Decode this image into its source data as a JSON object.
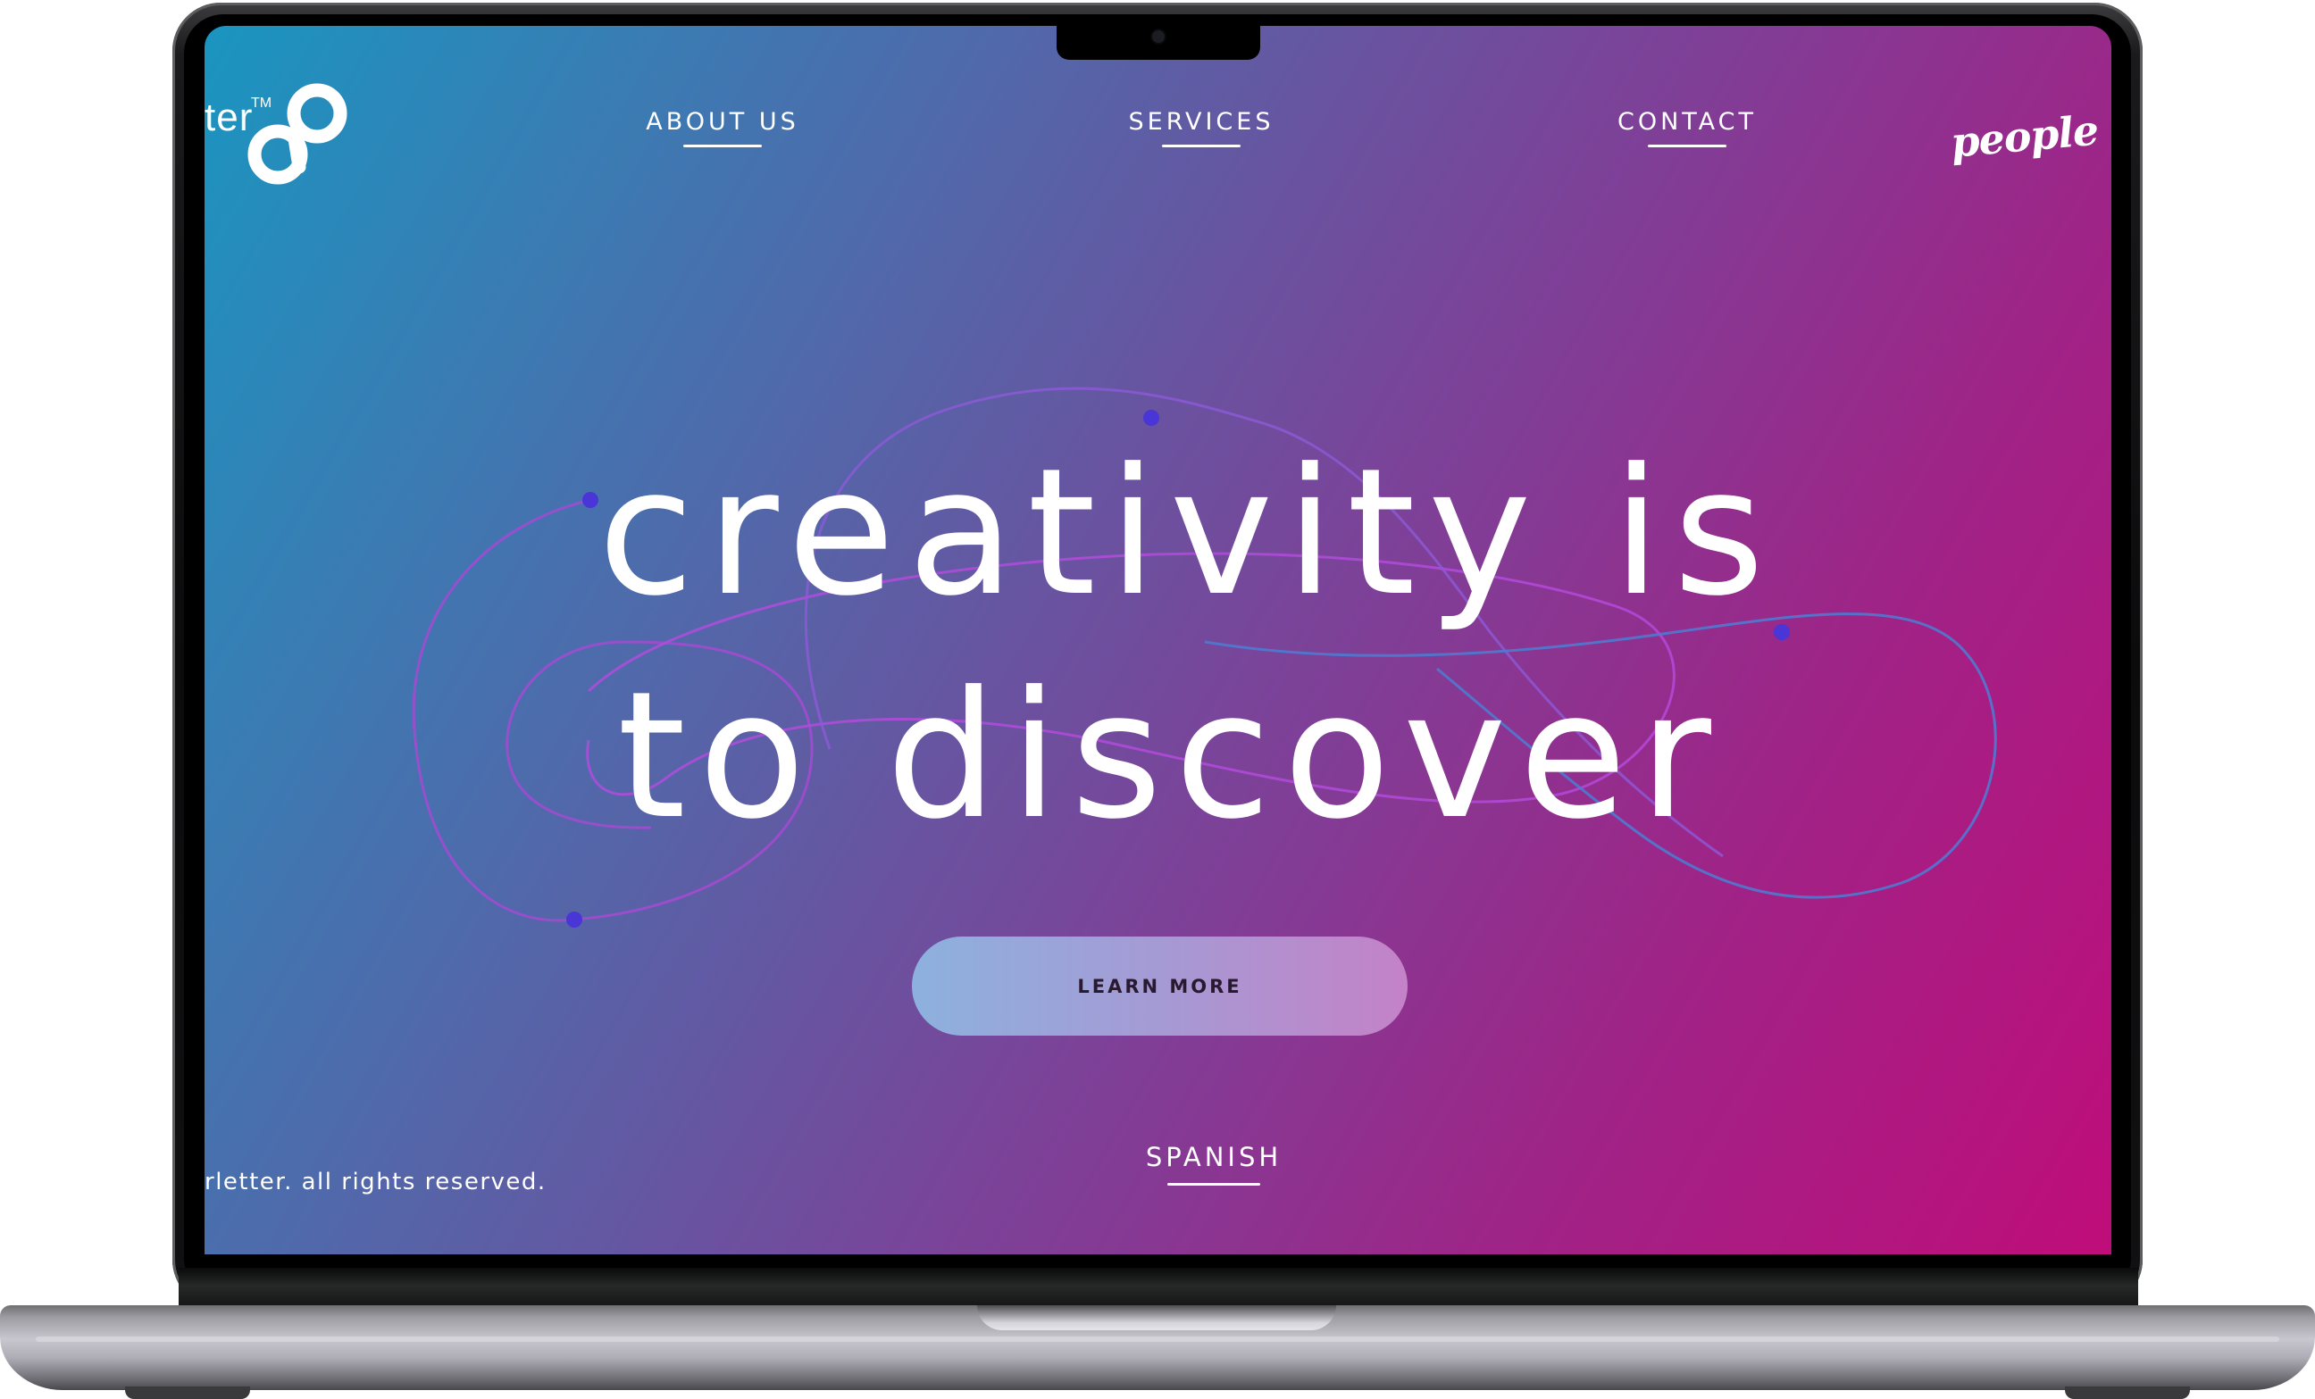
{
  "logo": {
    "text": "ter",
    "tm": "TM"
  },
  "nav": {
    "about": "ABOUT US",
    "services": "SERVICES",
    "contact": "CONTACT"
  },
  "tagline": "people cr",
  "hero": {
    "line1": "creativity is",
    "line2": "to discover"
  },
  "cta": {
    "label": "LEARN MORE"
  },
  "language": {
    "label": "SPANISH"
  },
  "footer": {
    "copyright": "rletter. all rights reserved."
  },
  "colors": {
    "gradient_start": "#1a95c0",
    "gradient_mid": "#7f3f97",
    "gradient_end": "#bf0d7a",
    "accent_dot": "#4a35d6",
    "curve": "#b04bd8"
  }
}
